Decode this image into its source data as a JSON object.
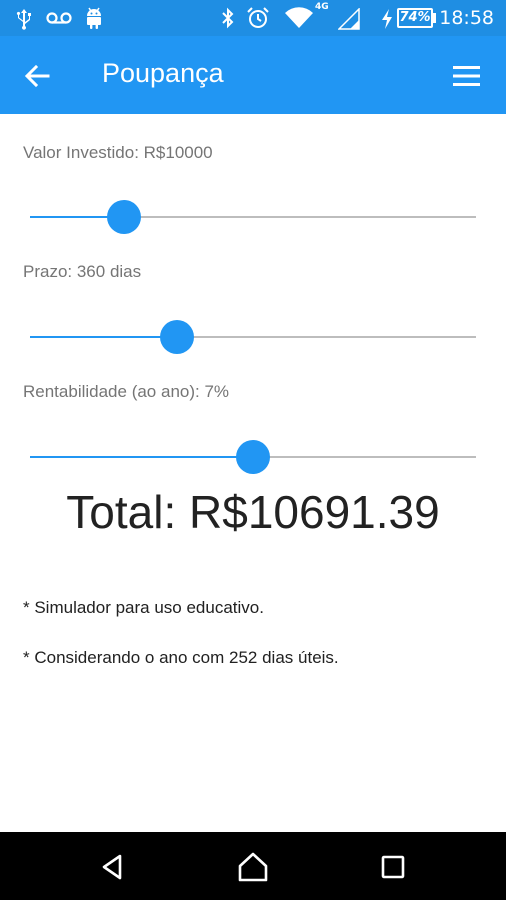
{
  "status_bar": {
    "time": "18:58",
    "battery": "74%",
    "network": "4G",
    "icons": [
      "usb-icon",
      "voicemail-icon",
      "android-icon",
      "bluetooth-icon",
      "alarm-icon",
      "wifi-icon",
      "signal-icon",
      "battery-charging-icon"
    ]
  },
  "app_bar": {
    "title": "Poupança",
    "back_icon": "arrow-back-icon",
    "menu_icon": "hamburger-menu-icon",
    "color": "#2196f3"
  },
  "sliders": {
    "investido": {
      "label": "Valor Investido: R$10000",
      "position": 0.21
    },
    "prazo": {
      "label": "Prazo: 360 dias",
      "position": 0.33
    },
    "rentabilidade": {
      "label": "Rentabilidade (ao ano): 7%",
      "position": 0.5
    }
  },
  "total": "Total: R$10691.39",
  "notes": [
    "* Simulador para uso educativo.",
    "* Considerando o ano com 252 dias úteis."
  ],
  "nav_bar": {
    "icons": [
      "nav-back-icon",
      "nav-home-icon",
      "nav-recents-icon"
    ]
  }
}
